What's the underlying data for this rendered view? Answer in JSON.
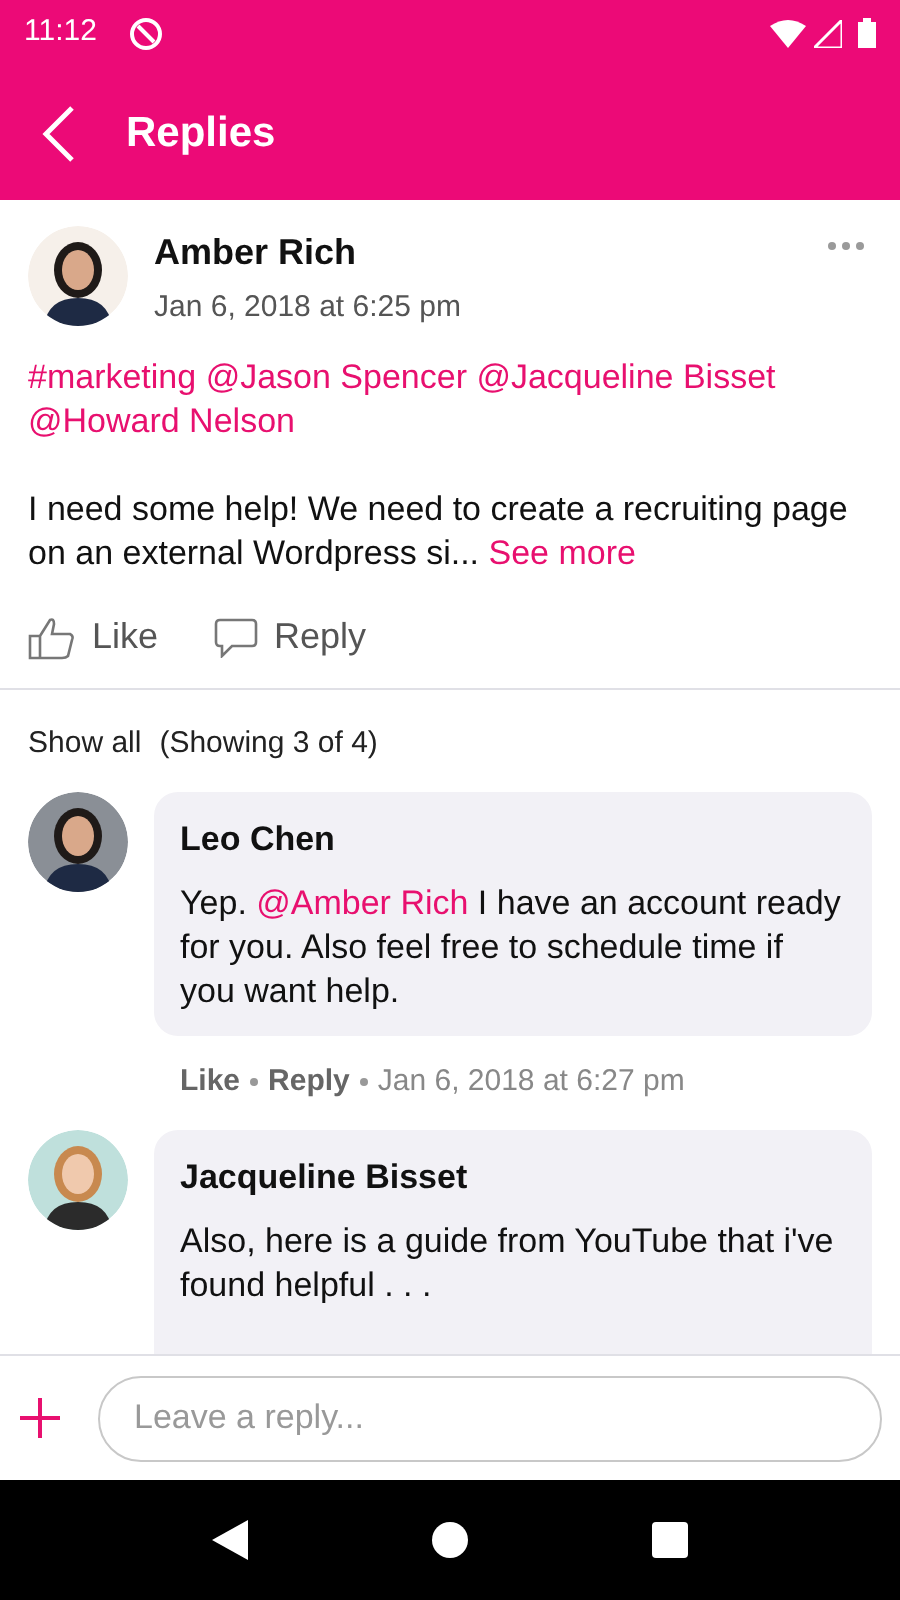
{
  "status_bar": {
    "time": "11:12"
  },
  "header": {
    "title": "Replies"
  },
  "post": {
    "author": "Amber Rich",
    "date": "Jan 6, 2018 at 6:25 pm",
    "tags": "#marketing @Jason Spencer @Jacqueline Bisset @Howard Nelson",
    "body": "I need some help! We need to create a recruiting page on an external Wordpress si...",
    "see_more": "See more",
    "actions": [
      {
        "kind": "like",
        "label": "Like"
      },
      {
        "kind": "reply",
        "label": "Reply"
      }
    ]
  },
  "thread": {
    "show_all": "Show all",
    "count": "(Showing 3 of 4)"
  },
  "comments": [
    {
      "author": "Leo Chen",
      "parts": [
        {
          "kind": "plain",
          "text": "Yep. "
        },
        {
          "kind": "mention",
          "text": "@Amber Rich"
        },
        {
          "kind": "plain",
          "text": " I have an account ready for you.  Also feel free to schedule time if you want help."
        }
      ],
      "like": "Like",
      "reply": "Reply",
      "date": "Jan 6, 2018 at 6:27 pm"
    },
    {
      "author": "Jacqueline Bisset",
      "parts": [
        {
          "kind": "plain",
          "text": "Also, here is a guide from YouTube that i've found helpful . . ."
        }
      ]
    }
  ],
  "composer": {
    "placeholder": "Leave a reply..."
  }
}
